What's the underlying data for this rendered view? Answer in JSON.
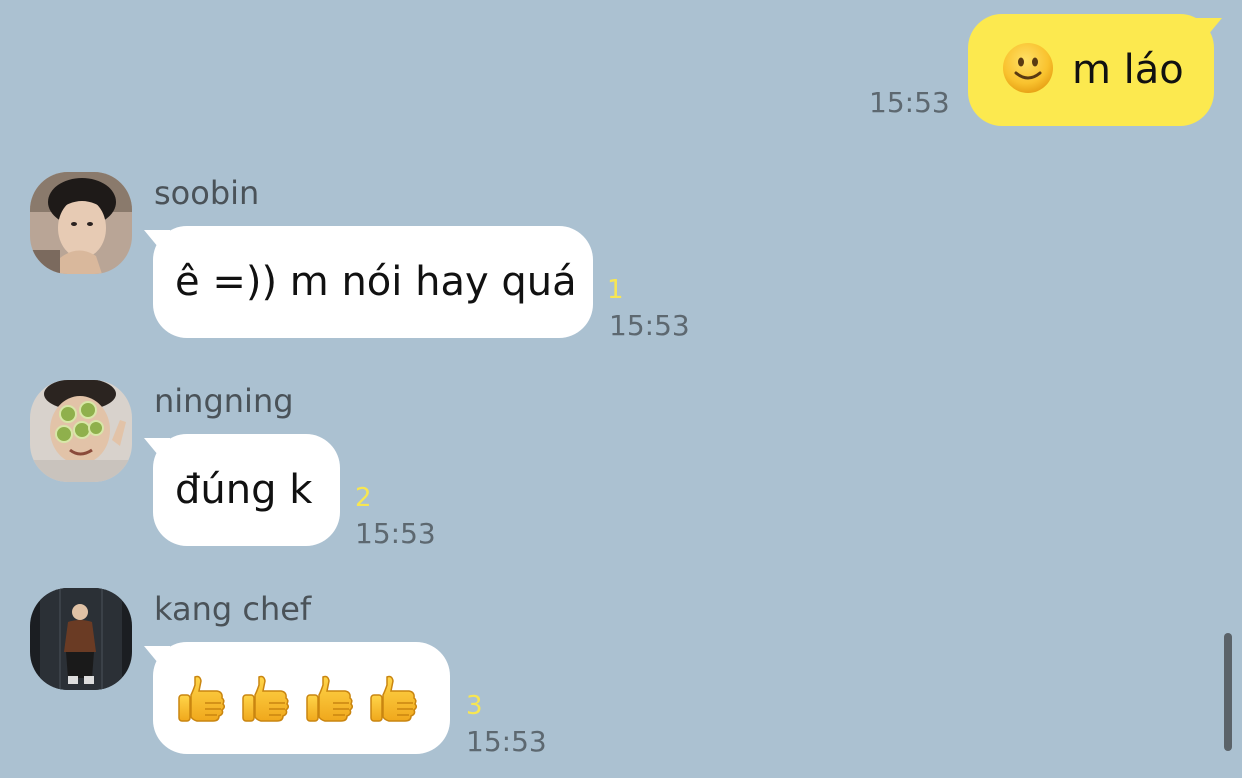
{
  "outgoing": {
    "emoji": "slightly-smiling-face-emoji",
    "text": "m láo",
    "time": "15:53"
  },
  "messages": [
    {
      "sender": "soobin",
      "text": "ê =)) m nói hay quá",
      "unread": "1",
      "time": "15:53"
    },
    {
      "sender": "ningning",
      "text": "đúng k",
      "unread": "2",
      "time": "15:53"
    },
    {
      "sender": "kang chef",
      "emoji": "thumbs-up-emoji",
      "emoji_count": 4,
      "unread": "3",
      "time": "15:53"
    }
  ],
  "colors": {
    "background": "#abc1d1",
    "outgoing_bubble": "#fce94f",
    "incoming_bubble": "#ffffff",
    "unread_count": "#f7e652",
    "timestamp": "#5d6870"
  }
}
